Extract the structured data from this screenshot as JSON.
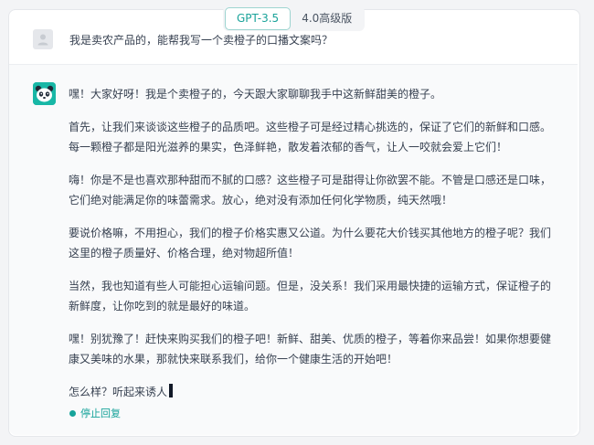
{
  "model_tabs": [
    {
      "label": "GPT-3.5",
      "active": true
    },
    {
      "label": "4.0高级版",
      "active": false
    }
  ],
  "user_message": "我是卖农产品的，能帮我写一个卖橙子的口播文案吗？",
  "assistant_paragraphs": [
    "嘿！大家好呀！我是个卖橙子的，今天跟大家聊聊我手中这新鲜甜美的橙子。",
    "首先，让我们来谈谈这些橙子的品质吧。这些橙子可是经过精心挑选的，保证了它们的新鲜和口感。每一颗橙子都是阳光滋养的果实，色泽鲜艳，散发着浓郁的香气，让人一咬就会爱上它们！",
    "嗨！你是不是也喜欢那种甜而不腻的口感？这些橙子可是甜得让你欲罢不能。不管是口感还是口味，它们绝对能满足你的味蕾需求。放心，绝对没有添加任何化学物质，纯天然哦！",
    "要说价格嘛，不用担心，我们的橙子价格实惠又公道。为什么要花大价钱买其他地方的橙子呢？我们这里的橙子质量好、价格合理，绝对物超所值！",
    "当然，我也知道有些人可能担心运输问题。但是，没关系！我们采用最快捷的运输方式，保证橙子的新鲜度，让你吃到的就是最好的味道。",
    "嘿！别犹豫了！赶快来购买我们的橙子吧！新鲜、甜美、优质的橙子，等着你来品尝！如果你想要健康又美味的水果，那就快来联系我们，给你一个健康生活的开始吧！",
    "怎么样？听起来诱人"
  ],
  "stop_label": "停止回复",
  "colors": {
    "accent": "#16a39a",
    "avatar_bg": "#18b7a6"
  },
  "icons": {
    "user_avatar": "user-icon",
    "bot_avatar": "panda-icon",
    "stop": "stop-dot-icon"
  }
}
